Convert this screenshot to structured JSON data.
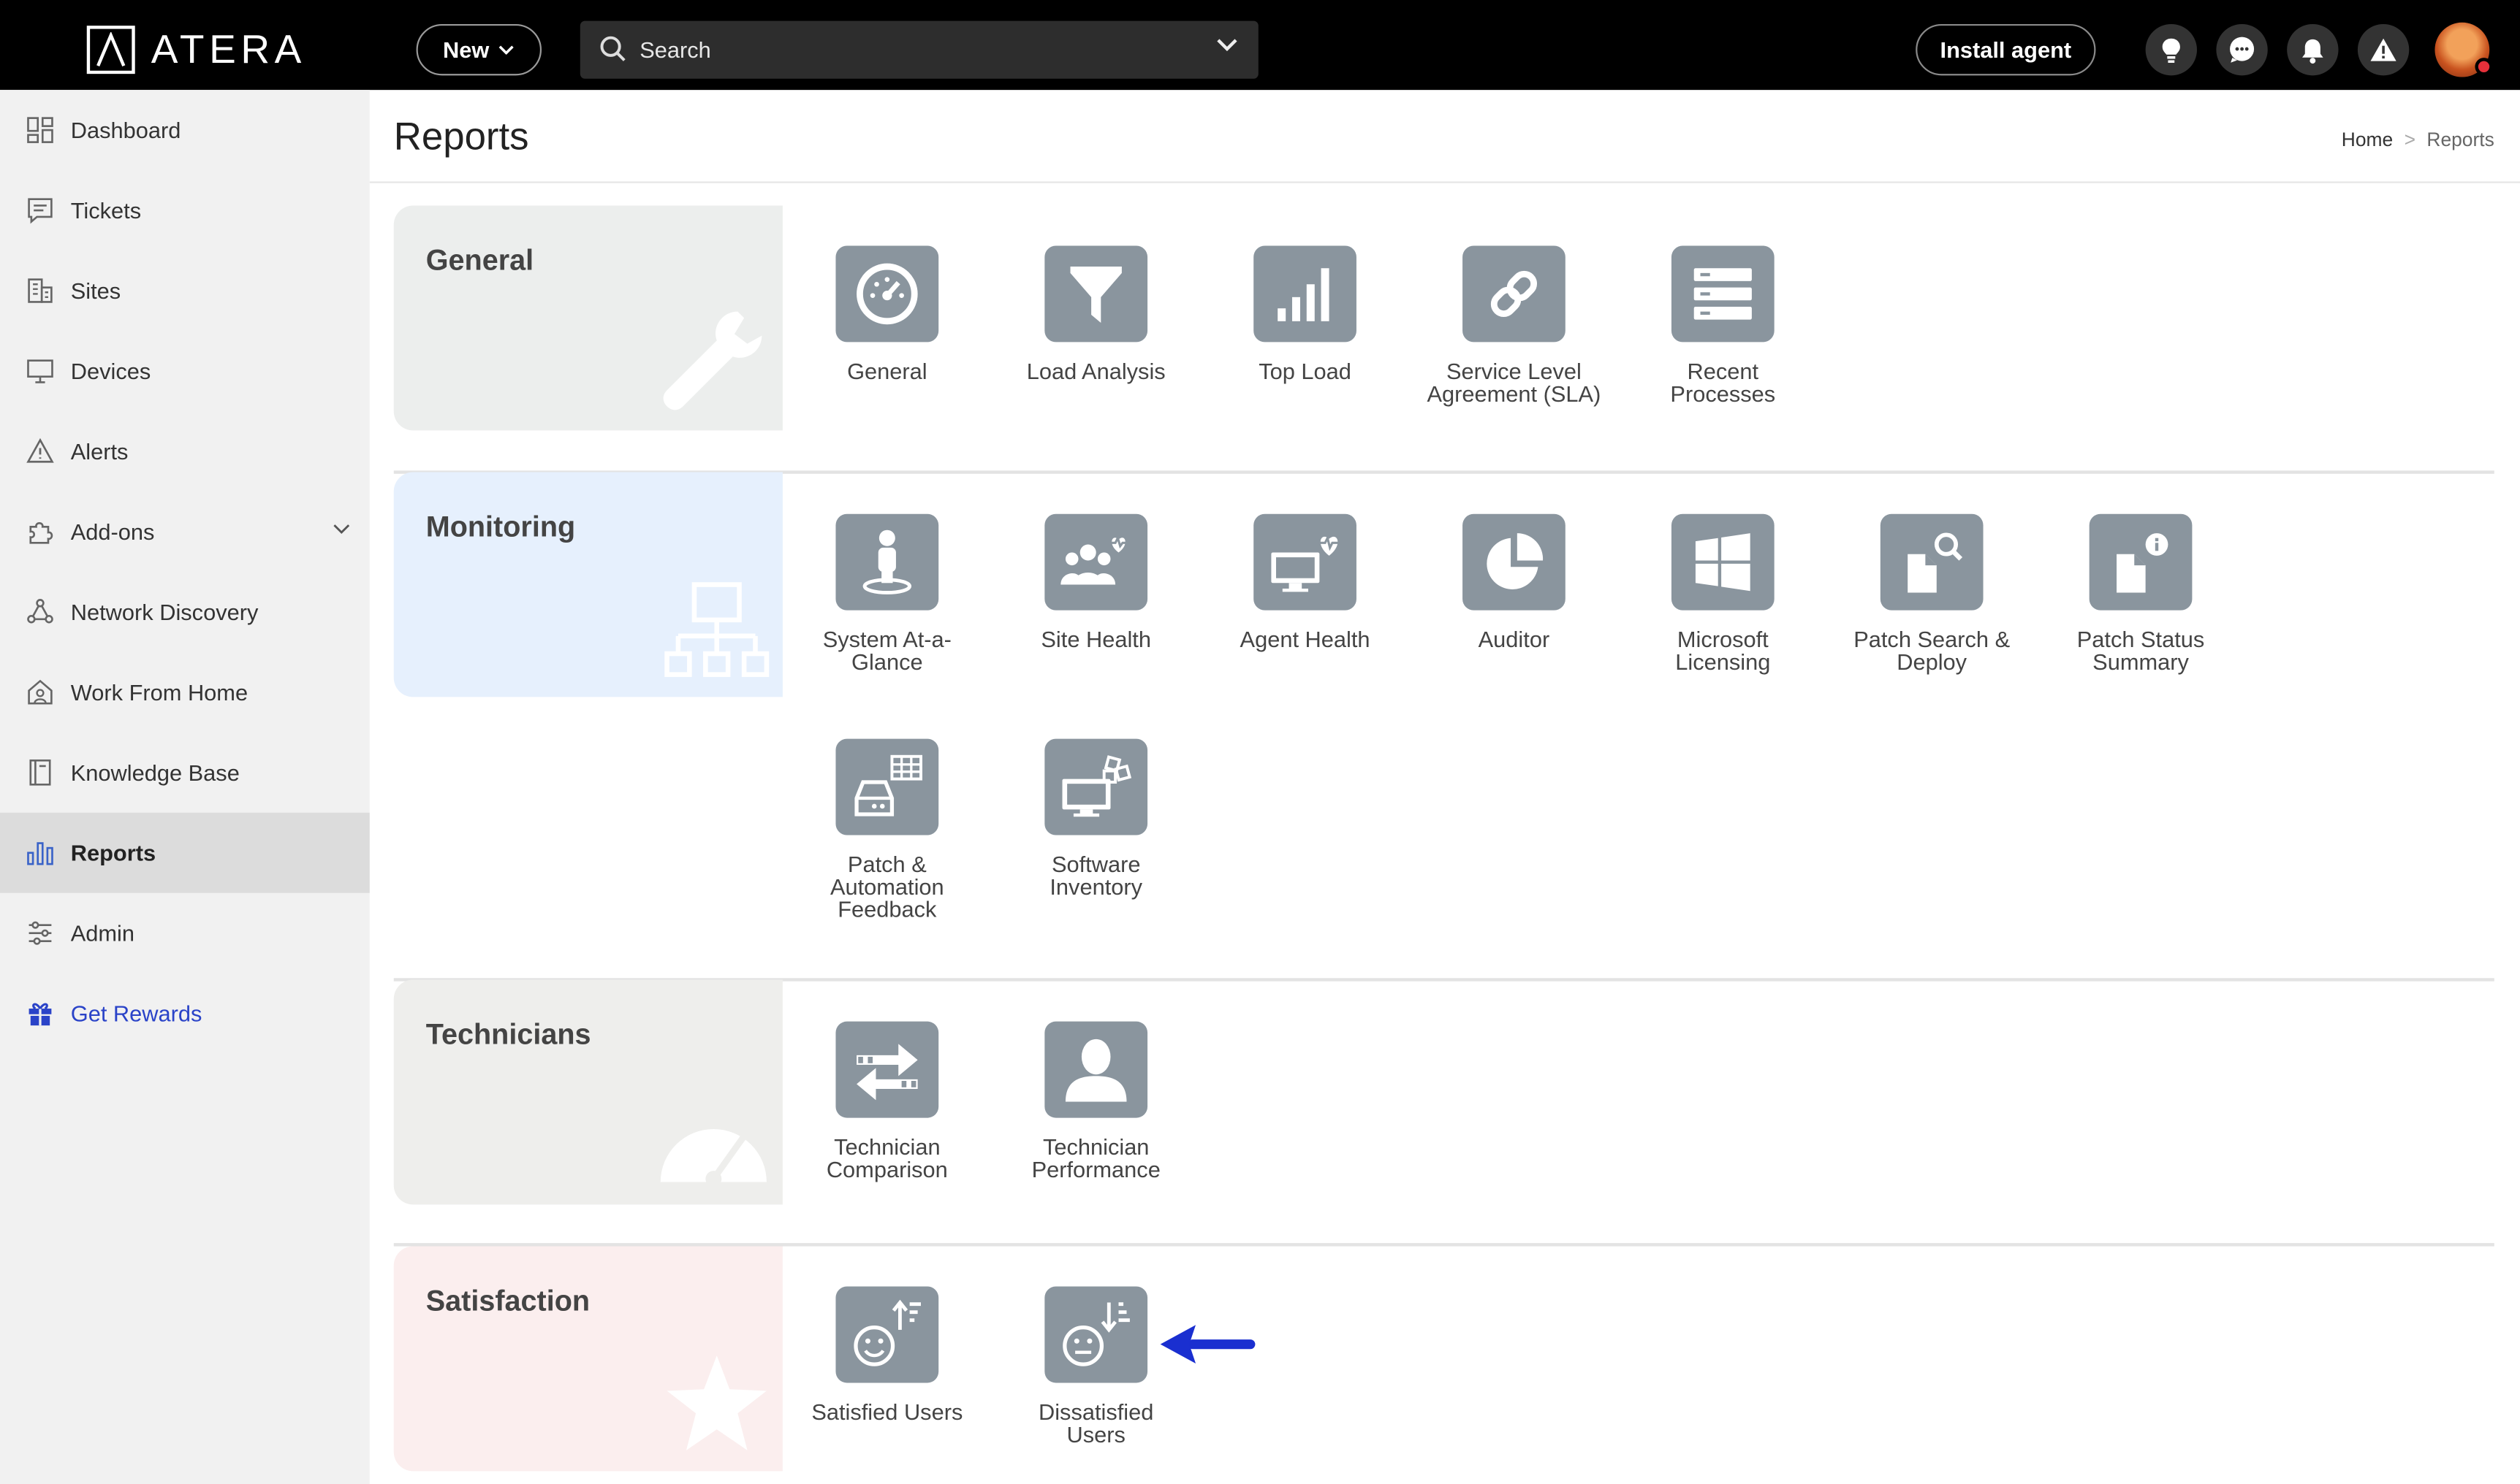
{
  "brand": {
    "name": "ATERA"
  },
  "topbar": {
    "new_label": "New",
    "search_label": "Search",
    "install_label": "Install agent",
    "icons": [
      "lightbulb-icon",
      "chat-icon",
      "bell-icon",
      "warning-icon"
    ]
  },
  "sidebar": {
    "items": [
      {
        "label": "Dashboard",
        "icon": "dashboard-icon"
      },
      {
        "label": "Tickets",
        "icon": "tickets-icon"
      },
      {
        "label": "Sites",
        "icon": "sites-icon"
      },
      {
        "label": "Devices",
        "icon": "devices-icon"
      },
      {
        "label": "Alerts",
        "icon": "alerts-icon"
      },
      {
        "label": "Add-ons",
        "icon": "addons-icon"
      },
      {
        "label": "Network Discovery",
        "icon": "network-icon"
      },
      {
        "label": "Work From Home",
        "icon": "home-icon"
      },
      {
        "label": "Knowledge Base",
        "icon": "book-icon"
      },
      {
        "label": "Reports",
        "icon": "reports-icon",
        "active": true
      },
      {
        "label": "Admin",
        "icon": "admin-icon"
      },
      {
        "label": "Get Rewards",
        "icon": "gift-icon"
      }
    ]
  },
  "page": {
    "title": "Reports",
    "breadcrumb": {
      "home": "Home",
      "separator": ">",
      "current": "Reports"
    }
  },
  "sections": {
    "general": {
      "title": "General",
      "tiles": [
        "General",
        "Load Analysis",
        "Top Load",
        "Service Level\nAgreement (SLA)",
        "Recent\nProcesses"
      ]
    },
    "monitoring": {
      "title": "Monitoring",
      "tiles": [
        "System At-a-\nGlance",
        "Site Health",
        "Agent Health",
        "Auditor",
        "Microsoft\nLicensing",
        "Patch Search &\nDeploy",
        "Patch Status\nSummary",
        "Patch &\nAutomation\nFeedback",
        "Software\nInventory"
      ]
    },
    "technicians": {
      "title": "Technicians",
      "tiles": [
        "Technician\nComparison",
        "Technician\nPerformance"
      ]
    },
    "satisfaction": {
      "title": "Satisfaction",
      "tiles": [
        "Satisfied Users",
        "Dissatisfied\nUsers"
      ]
    }
  },
  "colors": {
    "tile_bg": "#8a959e",
    "general_bg": "#eceeed",
    "monitoring_bg": "#e6f0fd",
    "technicians_bg": "#eeeeec",
    "satisfaction_bg": "#fbeeee",
    "arrow": "#1a2fd0"
  }
}
